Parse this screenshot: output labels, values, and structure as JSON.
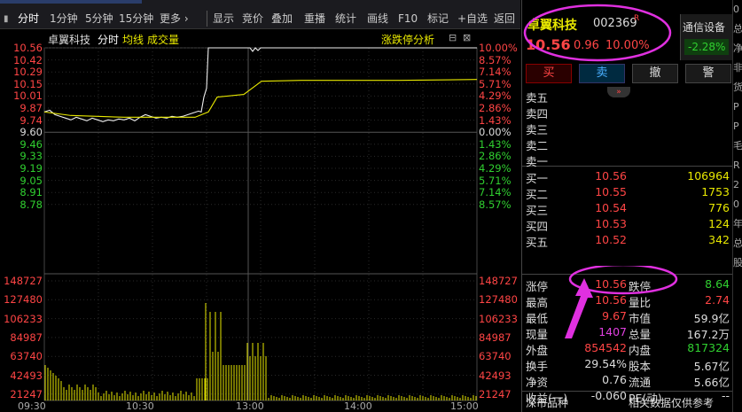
{
  "toolbar": {
    "items": [
      "分时",
      "1分钟",
      "5分钟",
      "15分钟",
      "更多 ›",
      "显示",
      "竞价",
      "叠加",
      "重播",
      "统计",
      "画线",
      "F10",
      "标记",
      "+自选",
      "返回"
    ]
  },
  "chart": {
    "name": "卓翼科技",
    "period": "分时",
    "avg_label": "均线",
    "vol_label": "成交量",
    "analysis_label": "涨跌停分析",
    "price_ticks": [
      "10.56",
      "10.42",
      "10.29",
      "10.15",
      "10.01",
      "9.87",
      "9.74",
      "9.60",
      "9.46",
      "9.33",
      "9.19",
      "9.05",
      "8.91",
      "8.78"
    ],
    "pct_ticks": [
      "10.00%",
      "8.57%",
      "7.14%",
      "5.71%",
      "4.29%",
      "2.86%",
      "1.43%",
      "0.00%",
      "1.43%",
      "2.86%",
      "4.29%",
      "5.71%",
      "7.14%",
      "8.57%"
    ],
    "volume_ticks": [
      "148727",
      "127480",
      "106233",
      "84987",
      "63740",
      "42493",
      "21247"
    ],
    "time_ticks": [
      "09:30",
      "10:30",
      "13:00",
      "14:00",
      "15:00"
    ]
  },
  "chart_data": {
    "type": "line",
    "x": [
      "09:30",
      "10:30",
      "13:00",
      "14:00",
      "15:00"
    ],
    "series": [],
    "ylim": [
      8.64,
      10.56
    ],
    "prev_close": 9.6
  },
  "quote": {
    "name": "卓翼科技",
    "code": "002369",
    "flag": "R",
    "price": "10.56",
    "change": "0.96",
    "pct": "10.00%",
    "sector": "通信设备",
    "sector_pct": "-2.28%",
    "buttons": [
      "买",
      "卖",
      "撤",
      "警"
    ],
    "asks": [
      "卖五",
      "卖四",
      "卖三",
      "卖二",
      "卖一"
    ],
    "bids": [
      {
        "label": "买一",
        "price": "10.56",
        "vol": "106964"
      },
      {
        "label": "买二",
        "price": "10.55",
        "vol": "1753"
      },
      {
        "label": "买三",
        "price": "10.54",
        "vol": "776"
      },
      {
        "label": "买四",
        "price": "10.53",
        "vol": "124"
      },
      {
        "label": "买五",
        "price": "10.52",
        "vol": "342"
      }
    ],
    "stats": {
      "zt_label": "涨停",
      "zt": "10.56",
      "dt_label": "跌停",
      "dt": "8.64",
      "high_label": "最高",
      "high": "10.56",
      "lb_label": "量比",
      "lb": "2.74",
      "low_label": "最低",
      "low": "9.67",
      "sz_label": "市值",
      "sz": "59.9亿",
      "xl_label": "现量",
      "xl": "1407",
      "zl_label": "总量",
      "zl": "167.2万",
      "wp_label": "外盘",
      "wp": "854542",
      "np_label": "内盘",
      "np": "817324",
      "hs_label": "换手",
      "hs": "29.54%",
      "gb_label": "股本",
      "gb": "5.67亿",
      "jz_label": "净资",
      "jz": "0.76",
      "lt_label": "流通",
      "lt": "5.66亿",
      "sy_label": "收益(一)",
      "sy": "-0.060",
      "pe_label": "PE(动)",
      "pe": "--"
    },
    "footer_left": "深市品种",
    "footer_right": "相关数据仅供参考"
  },
  "edge_chars": [
    "0",
    "",
    "总",
    "净",
    "非",
    "货",
    "",
    "P",
    "P",
    "毛",
    "R",
    "2",
    "0",
    "年",
    "总",
    "",
    "股"
  ]
}
